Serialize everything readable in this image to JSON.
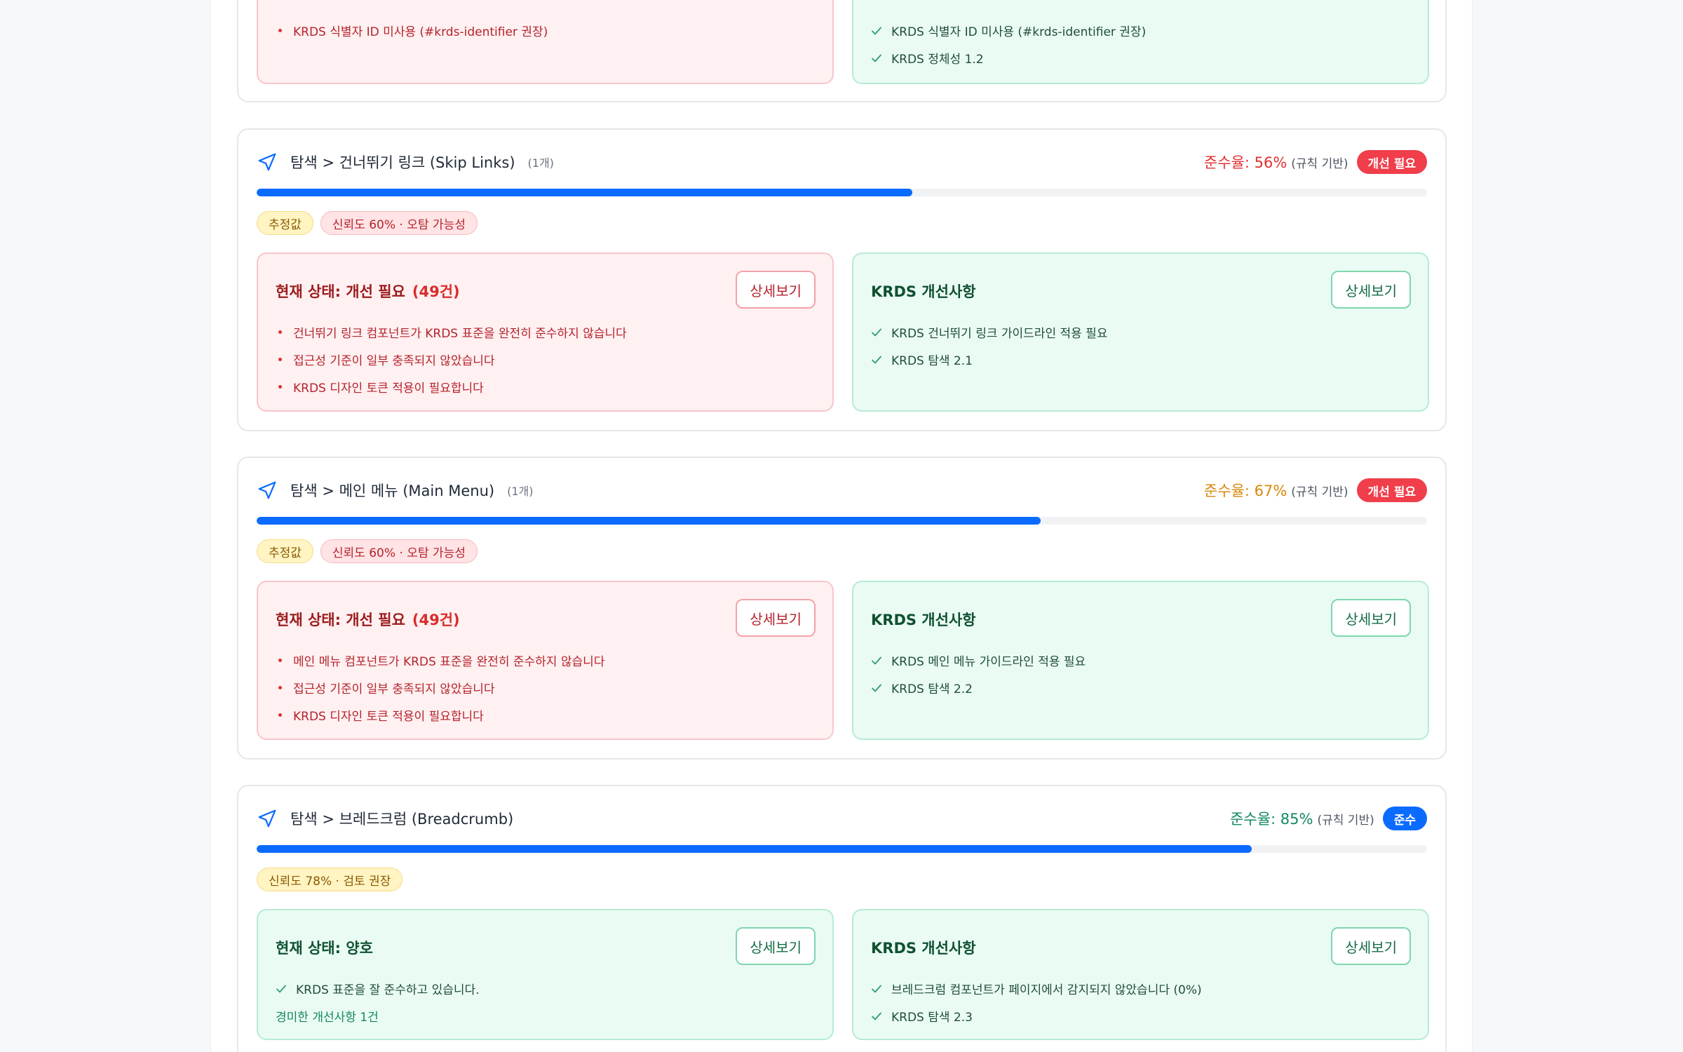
{
  "top_card": {
    "left_items": [
      "KRDS 식별자 ID 미사용 (#krds-identifier 권장)"
    ],
    "right_items": [
      "KRDS 식별자 ID 미사용 (#krds-identifier 권장)",
      "KRDS 정체성 1.2"
    ]
  },
  "cards": [
    {
      "title": "탐색 > 건너뛰기 링크 (Skip Links)",
      "count": "(1개)",
      "rate": "준수율: 56%",
      "rate_value": 56,
      "rate_color": "#e03131",
      "rate_note": "(규칙 기반)",
      "badge": "개선 필요",
      "tags": [
        "추정값",
        "신뢰도 60% · 오탐 가능성"
      ],
      "left_title": "현재 상태: 개선 필요",
      "left_count": "(49건)",
      "left_items": [
        "건너뛰기 링크 컴포넌트가 KRDS 표준을 완전히 준수하지 않습니다",
        "접근성 기준이 일부 충족되지 않았습니다",
        "KRDS 디자인 토큰 적용이 필요합니다"
      ],
      "right_title": "KRDS 개선사항",
      "right_items": [
        "KRDS 건너뛰기 링크 가이드라인 적용 필요",
        "KRDS 탐색 2.1"
      ],
      "detail_label": "상세보기"
    },
    {
      "title": "탐색 > 메인 메뉴 (Main Menu)",
      "count": "(1개)",
      "rate": "준수율: 67%",
      "rate_value": 67,
      "rate_color": "#d9880b",
      "rate_note": "(규칙 기반)",
      "badge": "개선 필요",
      "tags": [
        "추정값",
        "신뢰도 60% · 오탐 가능성"
      ],
      "left_title": "현재 상태: 개선 필요",
      "left_count": "(49건)",
      "left_items": [
        "메인 메뉴 컴포넌트가 KRDS 표준을 완전히 준수하지 않습니다",
        "접근성 기준이 일부 충족되지 않았습니다",
        "KRDS 디자인 토큰 적용이 필요합니다"
      ],
      "right_title": "KRDS 개선사항",
      "right_items": [
        "KRDS 메인 메뉴 가이드라인 적용 필요",
        "KRDS 탐색 2.2"
      ],
      "detail_label": "상세보기"
    },
    {
      "title": "탐색 > 브레드크럼 (Breadcrumb)",
      "rate": "준수율: 85%",
      "rate_value": 85,
      "rate_color": "#13895f",
      "rate_note": "(규칙 기반)",
      "badge": "준수",
      "tags": [
        "신뢰도 78% · 검토 권장"
      ],
      "left_title": "현재 상태: 양호",
      "left_items": [
        "KRDS 표준을 잘 준수하고 있습니다."
      ],
      "left_extra": "경미한 개선사항 1건",
      "right_title": "KRDS 개선사항",
      "right_items": [
        "브레드크럼 컴포넌트가 페이지에서 감지되지 않았습니다 (0%)",
        "KRDS 탐색 2.3"
      ],
      "detail_label": "상세보기"
    }
  ],
  "colors": {
    "accent": "#0b6bff",
    "danger": "#f03e4a",
    "success": "#13895f",
    "warning": "#d9880b"
  }
}
